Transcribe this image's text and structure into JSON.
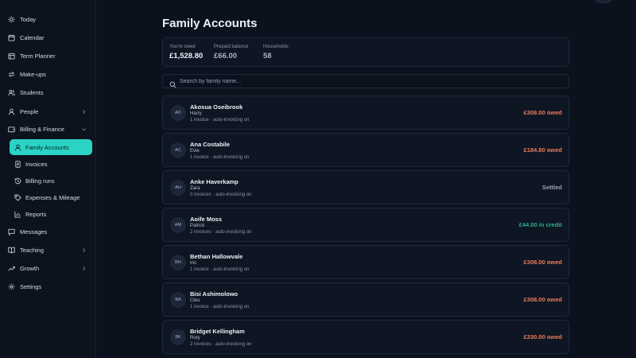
{
  "sidebar": {
    "items": [
      {
        "label": "Today",
        "icon": "sun-icon"
      },
      {
        "label": "Calendar",
        "icon": "calendar-icon"
      },
      {
        "label": "Term Planner",
        "icon": "planner-icon"
      },
      {
        "label": "Make-ups",
        "icon": "swap-icon"
      },
      {
        "label": "Students",
        "icon": "students-icon"
      },
      {
        "label": "People",
        "icon": "person-icon"
      },
      {
        "label": "Billing & Finance",
        "icon": "wallet-icon"
      },
      {
        "label": "Messages",
        "icon": "message-icon"
      },
      {
        "label": "Teaching",
        "icon": "book-icon"
      },
      {
        "label": "Growth",
        "icon": "growth-icon"
      },
      {
        "label": "Settings",
        "icon": "gear-icon"
      }
    ],
    "billing_sub": [
      {
        "label": "Family Accounts",
        "icon": "person-icon",
        "active": true
      },
      {
        "label": "Invoices",
        "icon": "invoice-icon"
      },
      {
        "label": "Billing runs",
        "icon": "history-icon"
      },
      {
        "label": "Expenses & Mileage",
        "icon": "tag-icon"
      },
      {
        "label": "Reports",
        "icon": "chart-icon"
      }
    ]
  },
  "page": {
    "title": "Family Accounts"
  },
  "stats": {
    "owed_label": "You're owed",
    "owed_value": "£1,528.80",
    "prepaid_label": "Prepaid balance",
    "prepaid_value": "£66.00",
    "households_label": "Households",
    "households_value": "58"
  },
  "search": {
    "placeholder": "Search by family name...",
    "value": ""
  },
  "families": [
    {
      "initials": "AO",
      "name": "Akosua Oseibrook",
      "child": "Harry",
      "meta": "1 invoice · auto-invoicing on",
      "status": "£308.00 owed",
      "kind": "owed"
    },
    {
      "initials": "AC",
      "name": "Ana Costabile",
      "child": "Evie",
      "meta": "1 invoice · auto-invoicing on",
      "status": "£184.80 owed",
      "kind": "owed"
    },
    {
      "initials": "AH",
      "name": "Anke Haverkamp",
      "child": "Zara",
      "meta": "0 invoices · auto-invoicing on",
      "status": "Settled",
      "kind": "settled"
    },
    {
      "initials": "AM",
      "name": "Aoife Moss",
      "child": "Patrick",
      "meta": "2 invoices · auto-invoicing on",
      "status": "£44.00 in credit",
      "kind": "credit"
    },
    {
      "initials": "BH",
      "name": "Bethan Hallowvale",
      "child": "Iris",
      "meta": "1 invoice · auto-invoicing on",
      "status": "£308.00 owed",
      "kind": "owed"
    },
    {
      "initials": "BA",
      "name": "Bisi Ashimolowo",
      "child": "Cleo",
      "meta": "1 invoice · auto-invoicing on",
      "status": "£308.00 owed",
      "kind": "owed"
    },
    {
      "initials": "BK",
      "name": "Bridget Kellingham",
      "child": "Rory",
      "meta": "2 invoices · auto-invoicing on",
      "status": "£330.00 owed",
      "kind": "owed"
    }
  ],
  "colors": {
    "accent": "#2bd3c4",
    "owed": "#ea7d5b",
    "credit": "#2fae88",
    "settled": "#9aa4b4",
    "background": "#0b111d"
  }
}
